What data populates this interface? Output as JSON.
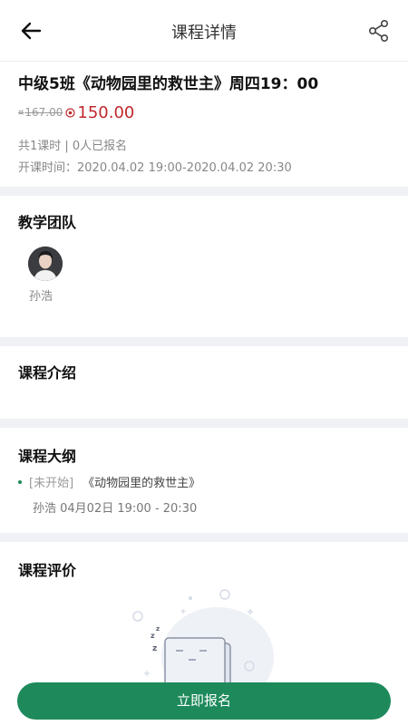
{
  "header": {
    "title": "课程详情"
  },
  "course": {
    "title": "中级5班《动物园里的救世主》周四19：00",
    "old_price": "167.00",
    "price": "150.00",
    "lessons_info": "共1课时 | 0人已报名",
    "start_time": "开课时间：2020.04.02 19:00-2020.04.02 20:30"
  },
  "team": {
    "heading": "教学团队",
    "teachers": [
      {
        "name": "孙浩"
      }
    ]
  },
  "intro": {
    "heading": "课程介绍"
  },
  "outline": {
    "heading": "课程大纲",
    "items": [
      {
        "status": "[未开始]",
        "title": "《动物园里的救世主》",
        "meta": "孙浩  04月02日 19:00 - 20:30"
      }
    ]
  },
  "reviews": {
    "heading": "课程评价"
  },
  "cta": {
    "label": "立即报名"
  },
  "colors": {
    "accent": "#1e8a5c",
    "price": "#c0282d",
    "divider": "#f0f1f5"
  },
  "icons": {
    "back": "back-arrow-icon",
    "share": "share-icon"
  }
}
